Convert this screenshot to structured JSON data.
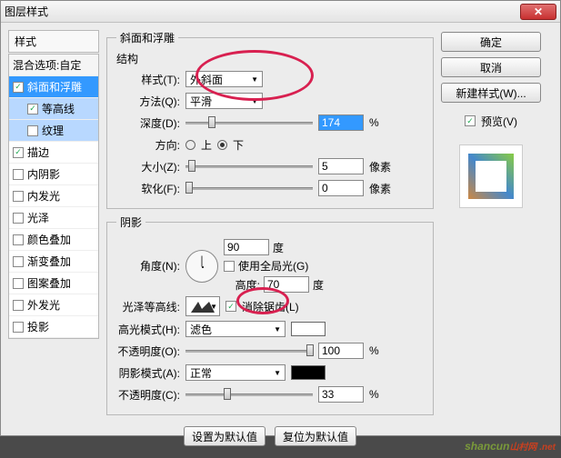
{
  "title": "图层样式",
  "left": {
    "header": "样式",
    "blend": "混合选项:自定",
    "items": [
      {
        "label": "斜面和浮雕",
        "checked": true,
        "selected": true,
        "indent": false
      },
      {
        "label": "等高线",
        "checked": true,
        "indent": true,
        "highlight": true
      },
      {
        "label": "纹理",
        "checked": false,
        "indent": true,
        "highlight": true
      },
      {
        "label": "描边",
        "checked": true,
        "indent": false
      },
      {
        "label": "内阴影",
        "checked": false,
        "indent": false
      },
      {
        "label": "内发光",
        "checked": false,
        "indent": false
      },
      {
        "label": "光泽",
        "checked": false,
        "indent": false
      },
      {
        "label": "颜色叠加",
        "checked": false,
        "indent": false
      },
      {
        "label": "渐变叠加",
        "checked": false,
        "indent": false
      },
      {
        "label": "图案叠加",
        "checked": false,
        "indent": false
      },
      {
        "label": "外发光",
        "checked": false,
        "indent": false
      },
      {
        "label": "投影",
        "checked": false,
        "indent": false
      }
    ]
  },
  "main_group": "斜面和浮雕",
  "structure": {
    "legend": "结构",
    "style_lbl": "样式(T):",
    "style_val": "外斜面",
    "tech_lbl": "方法(Q):",
    "tech_val": "平滑",
    "depth_lbl": "深度(D):",
    "depth_val": "174",
    "pct": "%",
    "dir_lbl": "方向:",
    "up": "上",
    "down": "下",
    "size_lbl": "大小(Z):",
    "size_val": "5",
    "px": "像素",
    "soften_lbl": "软化(F):",
    "soften_val": "0"
  },
  "shading": {
    "legend": "阴影",
    "angle_lbl": "角度(N):",
    "angle_val": "90",
    "deg": "度",
    "global": "使用全局光(G)",
    "alt_lbl": "高度:",
    "alt_val": "70",
    "gloss_lbl": "光泽等高线:",
    "aa": "消除锯齿(L)",
    "hl_mode_lbl": "高光模式(H):",
    "hl_mode_val": "滤色",
    "opacity_lbl": "不透明度(O):",
    "hl_op": "100",
    "sh_mode_lbl": "阴影模式(A):",
    "sh_mode_val": "正常",
    "sh_op_lbl": "不透明度(C):",
    "sh_op": "33"
  },
  "bottom": {
    "default": "设置为默认值",
    "reset": "复位为默认值"
  },
  "right": {
    "ok": "确定",
    "cancel": "取消",
    "newstyle": "新建样式(W)...",
    "preview": "预览(V)"
  },
  "wm": "shancun",
  "wm2": "山村网 .net"
}
